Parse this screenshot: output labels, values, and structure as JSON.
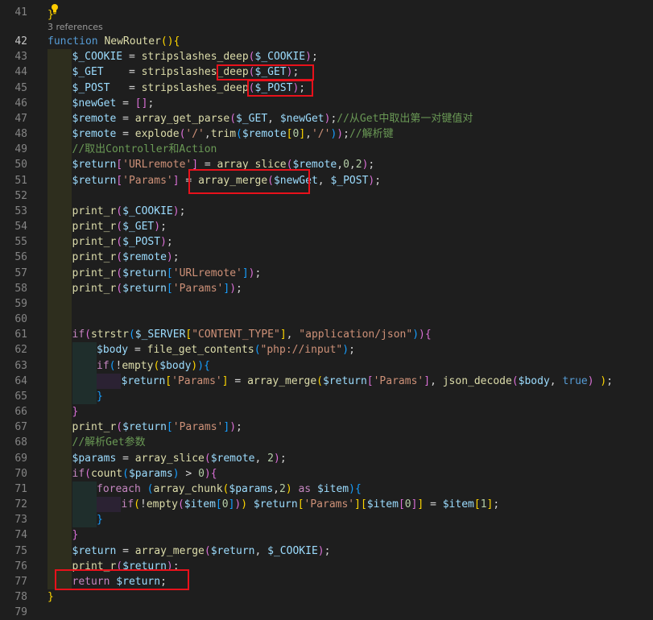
{
  "editor": {
    "references_label": "3 references",
    "first_line_tail": "}",
    "highlight_color": "#e8111b",
    "lines": [
      {
        "n": "41",
        "segs": []
      },
      {
        "n": "42",
        "segs": [
          [
            "kw",
            "function "
          ],
          [
            "fn",
            "NewRouter"
          ],
          [
            "br1",
            "()"
          ],
          [
            "br1",
            "{"
          ]
        ]
      },
      {
        "n": "43",
        "segs": [
          [
            "var",
            "$_COOKIE"
          ],
          [
            "pl",
            " = "
          ],
          [
            "fn",
            "stripslashes_deep"
          ],
          [
            "br2",
            "("
          ],
          [
            "var",
            "$_COOKIE"
          ],
          [
            "br2",
            ")"
          ],
          [
            "pl",
            ";"
          ]
        ]
      },
      {
        "n": "44",
        "segs": [
          [
            "var",
            "$_GET"
          ],
          [
            "pl",
            "    = "
          ],
          [
            "fn",
            "stripslashes_deep"
          ],
          [
            "br2",
            "("
          ],
          [
            "var",
            "$_GET"
          ],
          [
            "br2",
            ")"
          ],
          [
            "pl",
            ";"
          ]
        ]
      },
      {
        "n": "45",
        "segs": [
          [
            "var",
            "$_POST"
          ],
          [
            "pl",
            "   = "
          ],
          [
            "fn",
            "stripslashes_deep"
          ],
          [
            "br2",
            "("
          ],
          [
            "var",
            "$_POST"
          ],
          [
            "br2",
            ")"
          ],
          [
            "pl",
            ";"
          ]
        ]
      },
      {
        "n": "46",
        "segs": [
          [
            "var",
            "$newGet"
          ],
          [
            "pl",
            " = "
          ],
          [
            "br2",
            "[]"
          ],
          [
            "pl",
            ";"
          ]
        ]
      },
      {
        "n": "47",
        "segs": [
          [
            "var",
            "$remote"
          ],
          [
            "pl",
            " = "
          ],
          [
            "fn",
            "array_get_parse"
          ],
          [
            "br2",
            "("
          ],
          [
            "var",
            "$_GET"
          ],
          [
            "pl",
            ", "
          ],
          [
            "var",
            "$newGet"
          ],
          [
            "br2",
            ")"
          ],
          [
            "pl",
            ";"
          ],
          [
            "cm",
            "//从Get中取出第一对键值对"
          ]
        ]
      },
      {
        "n": "48",
        "segs": [
          [
            "var",
            "$remote"
          ],
          [
            "pl",
            " = "
          ],
          [
            "fn",
            "explode"
          ],
          [
            "br2",
            "("
          ],
          [
            "str",
            "'/'"
          ],
          [
            "pl",
            ","
          ],
          [
            "fn",
            "trim"
          ],
          [
            "br3",
            "("
          ],
          [
            "var",
            "$remote"
          ],
          [
            "br1",
            "["
          ],
          [
            "num",
            "0"
          ],
          [
            "br1",
            "]"
          ],
          [
            "pl",
            ","
          ],
          [
            "str",
            "'/'"
          ],
          [
            "br3",
            ")"
          ],
          [
            "br2",
            ")"
          ],
          [
            "pl",
            ";"
          ],
          [
            "cm",
            "//解析键"
          ]
        ]
      },
      {
        "n": "49",
        "segs": [
          [
            "cm",
            "//取出Controller和Action"
          ]
        ]
      },
      {
        "n": "50",
        "segs": [
          [
            "var",
            "$return"
          ],
          [
            "br2",
            "["
          ],
          [
            "str",
            "'URLremote'"
          ],
          [
            "br2",
            "]"
          ],
          [
            "pl",
            " = "
          ],
          [
            "fn",
            "array_slice"
          ],
          [
            "br2",
            "("
          ],
          [
            "var",
            "$remote"
          ],
          [
            "pl",
            ","
          ],
          [
            "num",
            "0"
          ],
          [
            "pl",
            ","
          ],
          [
            "num",
            "2"
          ],
          [
            "br2",
            ")"
          ],
          [
            "pl",
            ";"
          ]
        ]
      },
      {
        "n": "51",
        "segs": [
          [
            "var",
            "$return"
          ],
          [
            "br2",
            "["
          ],
          [
            "str",
            "'Params'"
          ],
          [
            "br2",
            "]"
          ],
          [
            "pl",
            " = "
          ],
          [
            "fn",
            "array_merge"
          ],
          [
            "br2",
            "("
          ],
          [
            "var",
            "$newGet"
          ],
          [
            "pl",
            ", "
          ],
          [
            "var",
            "$_POST"
          ],
          [
            "br2",
            ")"
          ],
          [
            "pl",
            ";"
          ]
        ]
      },
      {
        "n": "52",
        "segs": []
      },
      {
        "n": "53",
        "segs": [
          [
            "fn",
            "print_r"
          ],
          [
            "br2",
            "("
          ],
          [
            "var",
            "$_COOKIE"
          ],
          [
            "br2",
            ")"
          ],
          [
            "pl",
            ";"
          ]
        ]
      },
      {
        "n": "54",
        "segs": [
          [
            "fn",
            "print_r"
          ],
          [
            "br2",
            "("
          ],
          [
            "var",
            "$_GET"
          ],
          [
            "br2",
            ")"
          ],
          [
            "pl",
            ";"
          ]
        ]
      },
      {
        "n": "55",
        "segs": [
          [
            "fn",
            "print_r"
          ],
          [
            "br2",
            "("
          ],
          [
            "var",
            "$_POST"
          ],
          [
            "br2",
            ")"
          ],
          [
            "pl",
            ";"
          ]
        ]
      },
      {
        "n": "56",
        "segs": [
          [
            "fn",
            "print_r"
          ],
          [
            "br2",
            "("
          ],
          [
            "var",
            "$remote"
          ],
          [
            "br2",
            ")"
          ],
          [
            "pl",
            ";"
          ]
        ]
      },
      {
        "n": "57",
        "segs": [
          [
            "fn",
            "print_r"
          ],
          [
            "br2",
            "("
          ],
          [
            "var",
            "$return"
          ],
          [
            "br3",
            "["
          ],
          [
            "str",
            "'URLremote'"
          ],
          [
            "br3",
            "]"
          ],
          [
            "br2",
            ")"
          ],
          [
            "pl",
            ";"
          ]
        ]
      },
      {
        "n": "58",
        "segs": [
          [
            "fn",
            "print_r"
          ],
          [
            "br2",
            "("
          ],
          [
            "var",
            "$return"
          ],
          [
            "br3",
            "["
          ],
          [
            "str",
            "'Params'"
          ],
          [
            "br3",
            "]"
          ],
          [
            "br2",
            ")"
          ],
          [
            "pl",
            ";"
          ]
        ]
      },
      {
        "n": "59",
        "segs": []
      },
      {
        "n": "60",
        "segs": []
      },
      {
        "n": "61",
        "segs": [
          [
            "ctl",
            "if"
          ],
          [
            "br2",
            "("
          ],
          [
            "fn",
            "strstr"
          ],
          [
            "br3",
            "("
          ],
          [
            "var",
            "$_SERVER"
          ],
          [
            "br1",
            "["
          ],
          [
            "str",
            "\"CONTENT_TYPE\""
          ],
          [
            "br1",
            "]"
          ],
          [
            "pl",
            ", "
          ],
          [
            "str",
            "\"application/json\""
          ],
          [
            "br3",
            ")"
          ],
          [
            "br2",
            ")"
          ],
          [
            "br2",
            "{"
          ]
        ]
      },
      {
        "n": "62",
        "segs": [
          [
            "var",
            "$body"
          ],
          [
            "pl",
            " = "
          ],
          [
            "fn",
            "file_get_contents"
          ],
          [
            "br3",
            "("
          ],
          [
            "str",
            "\"php://input\""
          ],
          [
            "br3",
            ")"
          ],
          [
            "pl",
            ";"
          ]
        ]
      },
      {
        "n": "63",
        "segs": [
          [
            "ctl",
            "if"
          ],
          [
            "br3",
            "("
          ],
          [
            "pl",
            "!"
          ],
          [
            "fn",
            "empty"
          ],
          [
            "br1",
            "("
          ],
          [
            "var",
            "$body"
          ],
          [
            "br1",
            ")"
          ],
          [
            "br3",
            ")"
          ],
          [
            "br3",
            "{"
          ]
        ]
      },
      {
        "n": "64",
        "segs": [
          [
            "var",
            "$return"
          ],
          [
            "br1",
            "["
          ],
          [
            "str",
            "'Params'"
          ],
          [
            "br1",
            "]"
          ],
          [
            "pl",
            " = "
          ],
          [
            "fn",
            "array_merge"
          ],
          [
            "br1",
            "("
          ],
          [
            "var",
            "$return"
          ],
          [
            "br2",
            "["
          ],
          [
            "str",
            "'Params'"
          ],
          [
            "br2",
            "]"
          ],
          [
            "pl",
            ", "
          ],
          [
            "fn",
            "json_decode"
          ],
          [
            "br2",
            "("
          ],
          [
            "var",
            "$body"
          ],
          [
            "pl",
            ", "
          ],
          [
            "kw",
            "true"
          ],
          [
            "br2",
            ")"
          ],
          [
            "pl",
            " "
          ],
          [
            "br1",
            ")"
          ],
          [
            "pl",
            ";"
          ]
        ]
      },
      {
        "n": "65",
        "segs": [
          [
            "br3",
            "}"
          ]
        ]
      },
      {
        "n": "66",
        "segs": [
          [
            "br2",
            "}"
          ]
        ]
      },
      {
        "n": "67",
        "segs": [
          [
            "fn",
            "print_r"
          ],
          [
            "br2",
            "("
          ],
          [
            "var",
            "$return"
          ],
          [
            "br3",
            "["
          ],
          [
            "str",
            "'Params'"
          ],
          [
            "br3",
            "]"
          ],
          [
            "br2",
            ")"
          ],
          [
            "pl",
            ";"
          ]
        ]
      },
      {
        "n": "68",
        "segs": [
          [
            "cm",
            "//解析Get参数"
          ]
        ]
      },
      {
        "n": "69",
        "segs": [
          [
            "var",
            "$params"
          ],
          [
            "pl",
            " = "
          ],
          [
            "fn",
            "array_slice"
          ],
          [
            "br2",
            "("
          ],
          [
            "var",
            "$remote"
          ],
          [
            "pl",
            ", "
          ],
          [
            "num",
            "2"
          ],
          [
            "br2",
            ")"
          ],
          [
            "pl",
            ";"
          ]
        ]
      },
      {
        "n": "70",
        "segs": [
          [
            "ctl",
            "if"
          ],
          [
            "br2",
            "("
          ],
          [
            "fn",
            "count"
          ],
          [
            "br3",
            "("
          ],
          [
            "var",
            "$params"
          ],
          [
            "br3",
            ")"
          ],
          [
            "pl",
            " > "
          ],
          [
            "num",
            "0"
          ],
          [
            "br2",
            ")"
          ],
          [
            "br2",
            "{"
          ]
        ]
      },
      {
        "n": "71",
        "segs": [
          [
            "ctl",
            "foreach"
          ],
          [
            "pl",
            " "
          ],
          [
            "br3",
            "("
          ],
          [
            "fn",
            "array_chunk"
          ],
          [
            "br1",
            "("
          ],
          [
            "var",
            "$params"
          ],
          [
            "pl",
            ","
          ],
          [
            "num",
            "2"
          ],
          [
            "br1",
            ")"
          ],
          [
            "pl",
            " "
          ],
          [
            "ctl",
            "as"
          ],
          [
            "pl",
            " "
          ],
          [
            "var",
            "$item"
          ],
          [
            "br3",
            ")"
          ],
          [
            "br3",
            "{"
          ]
        ]
      },
      {
        "n": "72",
        "segs": [
          [
            "ctl",
            "if"
          ],
          [
            "br1",
            "("
          ],
          [
            "pl",
            "!"
          ],
          [
            "fn",
            "empty"
          ],
          [
            "br2",
            "("
          ],
          [
            "var",
            "$item"
          ],
          [
            "br3",
            "["
          ],
          [
            "num",
            "0"
          ],
          [
            "br3",
            "]"
          ],
          [
            "br2",
            ")"
          ],
          [
            "br1",
            ")"
          ],
          [
            "pl",
            " "
          ],
          [
            "var",
            "$return"
          ],
          [
            "br1",
            "["
          ],
          [
            "str",
            "'Params'"
          ],
          [
            "br1",
            "]"
          ],
          [
            "br1",
            "["
          ],
          [
            "var",
            "$item"
          ],
          [
            "br2",
            "["
          ],
          [
            "num",
            "0"
          ],
          [
            "br2",
            "]"
          ],
          [
            "br1",
            "]"
          ],
          [
            "pl",
            " = "
          ],
          [
            "var",
            "$item"
          ],
          [
            "br1",
            "["
          ],
          [
            "num",
            "1"
          ],
          [
            "br1",
            "]"
          ],
          [
            "pl",
            ";"
          ]
        ]
      },
      {
        "n": "73",
        "segs": [
          [
            "br3",
            "}"
          ]
        ]
      },
      {
        "n": "74",
        "segs": [
          [
            "br2",
            "}"
          ]
        ]
      },
      {
        "n": "75",
        "segs": [
          [
            "var",
            "$return"
          ],
          [
            "pl",
            " = "
          ],
          [
            "fn",
            "array_merge"
          ],
          [
            "br2",
            "("
          ],
          [
            "var",
            "$return"
          ],
          [
            "pl",
            ", "
          ],
          [
            "var",
            "$_COOKIE"
          ],
          [
            "br2",
            ")"
          ],
          [
            "pl",
            ";"
          ]
        ]
      },
      {
        "n": "76",
        "segs": [
          [
            "fn",
            "print_r"
          ],
          [
            "br2",
            "("
          ],
          [
            "var",
            "$return"
          ],
          [
            "br2",
            ")"
          ],
          [
            "pl",
            ";"
          ]
        ]
      },
      {
        "n": "77",
        "segs": [
          [
            "ctl",
            "return"
          ],
          [
            "pl",
            " "
          ],
          [
            "var",
            "$return"
          ],
          [
            "pl",
            ";"
          ]
        ]
      },
      {
        "n": "78",
        "segs": [
          [
            "br1",
            "}"
          ]
        ]
      },
      {
        "n": "79",
        "segs": []
      }
    ]
  }
}
